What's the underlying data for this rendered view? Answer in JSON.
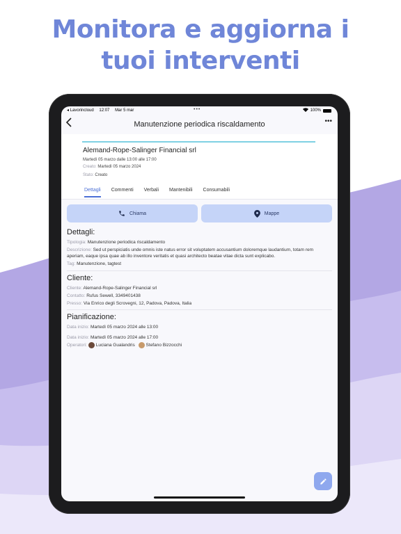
{
  "headline": {
    "line1": "Monitora e aggiorna i",
    "line2": "tuoi interventi"
  },
  "colors": {
    "accent": "#4b6fd6",
    "headline": "#6f86d8",
    "wave_purple": "#a99ee0"
  },
  "status_bar": {
    "back_app": "◂ Lavorincloud",
    "time": "12:07",
    "date": "Mar 5 mar",
    "battery": "100%"
  },
  "nav": {
    "title": "Manutenzione periodica riscaldamento",
    "back_icon": "chevron-left-icon",
    "more_icon": "more-icon"
  },
  "header": {
    "client": "Alemand-Rope-Salinger Financial srl",
    "schedule": "Martedì 05 marzo dalle 13:00 alle 17:00",
    "created_label": "Creato:",
    "created_value": "Martedì 05 marzo 2024",
    "status_label": "Stato:",
    "status_value": "Creato",
    "tabs": [
      "Dettagli",
      "Commenti",
      "Verbali",
      "Mantenibili",
      "Consumabili"
    ]
  },
  "actions": {
    "call": "Chiama",
    "maps": "Mappe"
  },
  "details": {
    "title": "Dettagli:",
    "type_label": "Tipologia:",
    "type_value": "Manutenzione periodica riscaldamento",
    "desc_label": "Descrizione:",
    "desc_value": "Sed ut perspiciatis unde omnis iste natus error sit voluptatem accusantium doloremque laudantium, totam rem aperiam, eaque ipsa quae ab illo inventore veritatis et quasi architecto beatae vitae dicta sunt explicabo.",
    "tag_label": "Tag:",
    "tag_value": "Manutenzione, tagtest"
  },
  "client": {
    "title": "Cliente:",
    "client_label": "Cliente:",
    "client_value": "Alemand-Rope-Salinger Financial srl",
    "contact_label": "Contatto:",
    "contact_value": "Rufus Sewell, 3349401438",
    "at_label": "Presso:",
    "at_value": "Via Enrico degli Scrovegni, 12, Padova, Padova, Italia"
  },
  "planning": {
    "title": "Pianificazione:",
    "start1_label": "Data inizio:",
    "start1_value": "Martedì 05 marzo 2024 alle 13:00",
    "start2_label": "Data inizio:",
    "start2_value": "Martedì 05 marzo 2024 alle 17:00",
    "operators_label": "Operatori:",
    "operators": [
      "Luciana Gualandris",
      "Stefano Bizzocchi"
    ]
  }
}
